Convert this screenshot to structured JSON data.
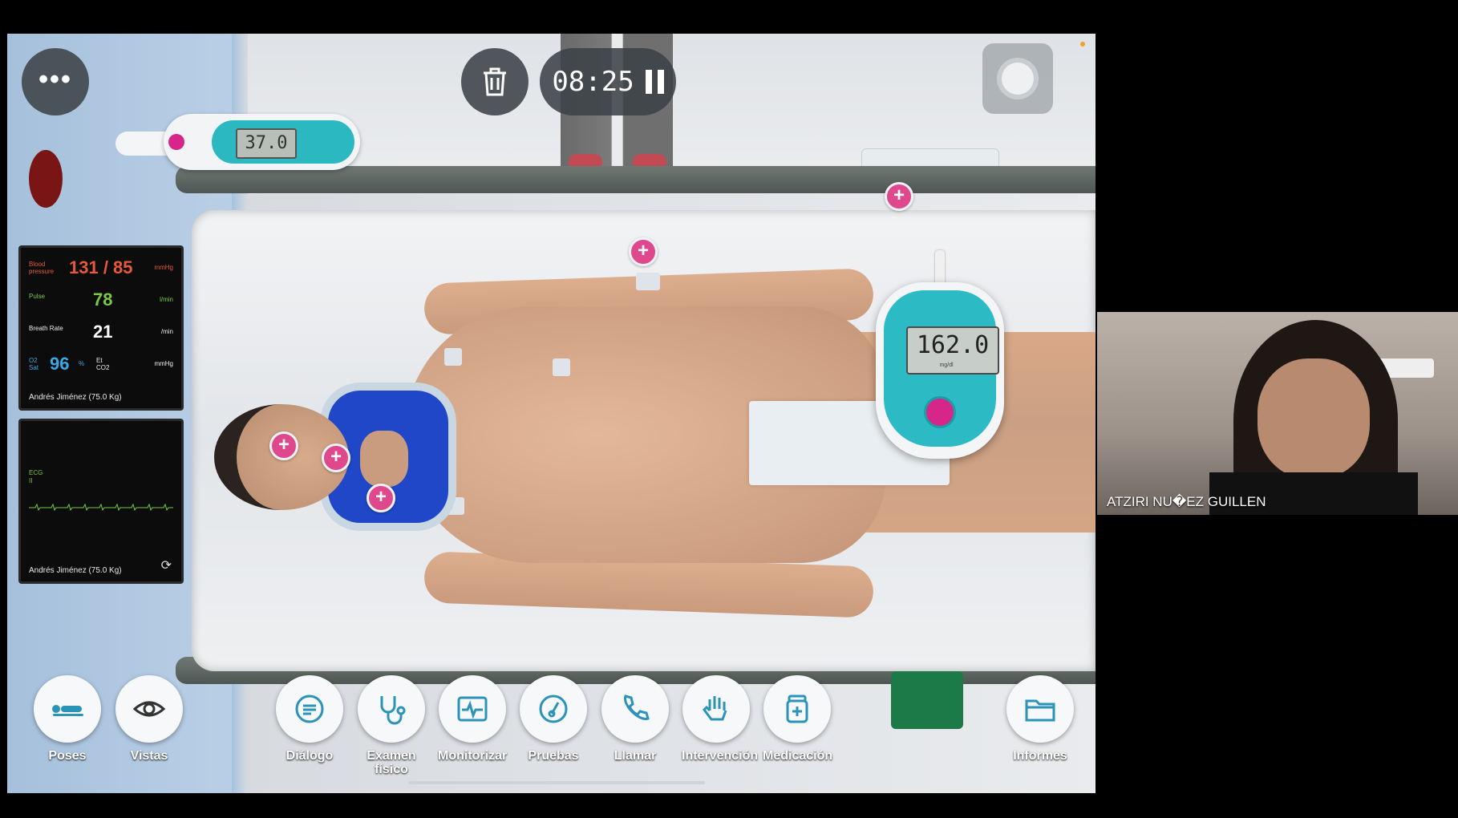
{
  "timer": {
    "time": "08:25"
  },
  "thermometer": {
    "reading": "37.0"
  },
  "glucometer": {
    "reading": "162.0",
    "unit": "mg/dl"
  },
  "vitals": {
    "bp_label": "Blood pressure",
    "bp_value": "131 / 85",
    "bp_unit": "mmHg",
    "pulse_label": "Pulse",
    "pulse_value": "78",
    "pulse_unit": "l/min",
    "breath_label": "Breath Rate",
    "breath_value": "21",
    "breath_unit": "/min",
    "o2_label": "O2 Sat",
    "o2_value": "96",
    "o2_unit": "%",
    "etco2_label": "Et CO2",
    "etco2_unit": "mmHg",
    "patient": "Andrés Jiménez (75.0 Kg)",
    "colors": {
      "bp": "#e8593a",
      "pulse": "#7dc842",
      "breath": "#ffffff",
      "o2": "#3aa8e6"
    }
  },
  "ecg": {
    "label": "ECG",
    "lead": "II",
    "patient": "Andrés Jiménez (75.0 Kg)"
  },
  "toolbar": {
    "poses": "Poses",
    "vistas": "Vistas",
    "dialogo": "Diálogo",
    "examen": "Examen físico",
    "monitorizar": "Monitorizar",
    "pruebas": "Pruebas",
    "llamar": "Llamar",
    "intervencion": "Intervención",
    "medicacion": "Medicación",
    "informes": "Informes"
  },
  "webcam": {
    "name": "ATZIRI NU�EZ GUILLEN"
  },
  "accent": {
    "pink": "#e0488e",
    "teal": "#2cbbc4",
    "icon": "#2b93b8"
  }
}
